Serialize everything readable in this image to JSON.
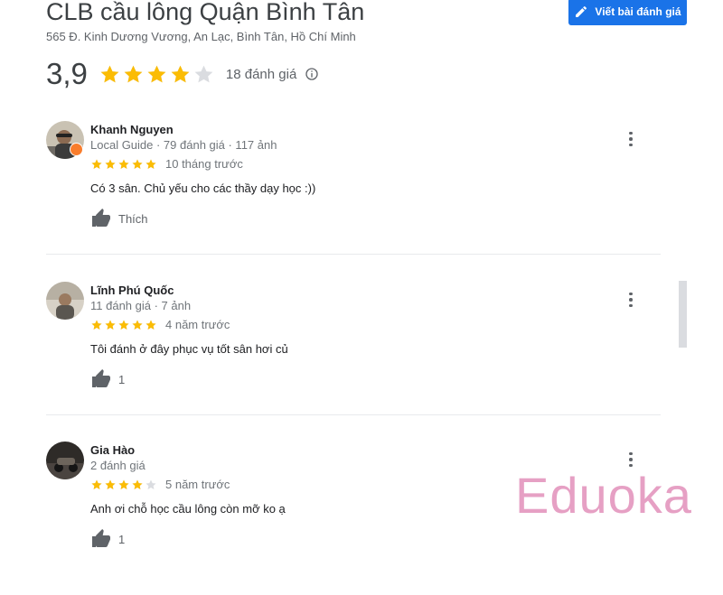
{
  "place": {
    "title": "CLB cầu lông Quận Bình Tân",
    "address": "565 Đ. Kinh Dương Vương, An Lạc, Bình Tân, Hồ Chí Minh",
    "rating": "3,9",
    "rating_value": 3.9,
    "review_count": "18 đánh giá",
    "write_review_label": "Viết bài đánh giá"
  },
  "reviews": [
    {
      "author": "Khanh Nguyen",
      "meta": "Local Guide · 79 đánh giá · 117 ảnh",
      "stars": 5,
      "time": "10 tháng trước",
      "text": "Có 3 sân. Chủ yếu cho các thầy dạy học :))",
      "like_label": "Thích"
    },
    {
      "author": "Lĩnh Phú Quốc",
      "meta": "11 đánh giá · 7 ảnh",
      "stars": 5,
      "time": "4 năm trước",
      "text": "Tôi đánh ở đây phục vụ tốt sân hơi củ",
      "like_label": "1"
    },
    {
      "author": "Gia Hào",
      "meta": "2 đánh giá",
      "stars": 4,
      "time": "5 năm trước",
      "text": "Anh ơi chỗ học cầu lông còn mỡ ko ạ",
      "like_label": "1"
    }
  ],
  "colors": {
    "accent": "#1a73e8",
    "star": "#fbbc04",
    "star_empty": "#dadce0",
    "watermark": "#e6a0c4"
  },
  "icons": [
    "pencil-icon",
    "star-icon",
    "info-icon",
    "thumbs-up-icon",
    "more-vert-icon",
    "local-guide-badge-icon"
  ],
  "watermark": "Eduoka"
}
